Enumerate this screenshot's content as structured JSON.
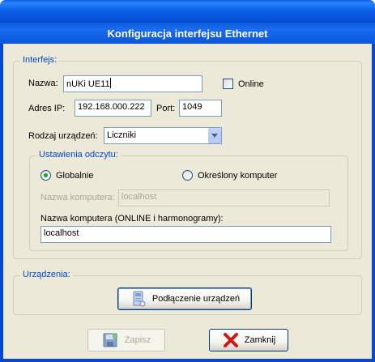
{
  "window": {
    "title": "Konfiguracja interfejsu Ethernet"
  },
  "interface_group": {
    "legend": "Interfejs:",
    "name_label": "Nazwa:",
    "name_value": "nUKi UE11",
    "online_label": "Online",
    "online_checked": false,
    "ip_label": "Adres IP:",
    "ip_value": "192.168.000.222",
    "port_label": "Port:",
    "port_value": "1049",
    "device_type_label": "Rodzaj urządzeń:",
    "device_type_value": "Liczniki"
  },
  "read_settings": {
    "legend": "Ustawienia odczytu:",
    "global_label": "Globalnie",
    "global_selected": true,
    "specific_label": "Określony komputer",
    "specific_selected": false,
    "computer_name_label": "Nazwa komputera:",
    "computer_name_value": "localhost",
    "online_computer_label": "Nazwa komputera (ONLINE i harmonogramy):",
    "online_computer_value": "localhost"
  },
  "devices_group": {
    "legend": "Urządzenia:",
    "connect_button": "Podłączenie urządzeń"
  },
  "buttons": {
    "save": "Zapisz",
    "close": "Zamknij"
  },
  "colors": {
    "titlebar": "#0a5ee6",
    "legend_text": "#0046d5",
    "dialog_bg": "#ece9d8",
    "radio_dot": "#21a121"
  }
}
